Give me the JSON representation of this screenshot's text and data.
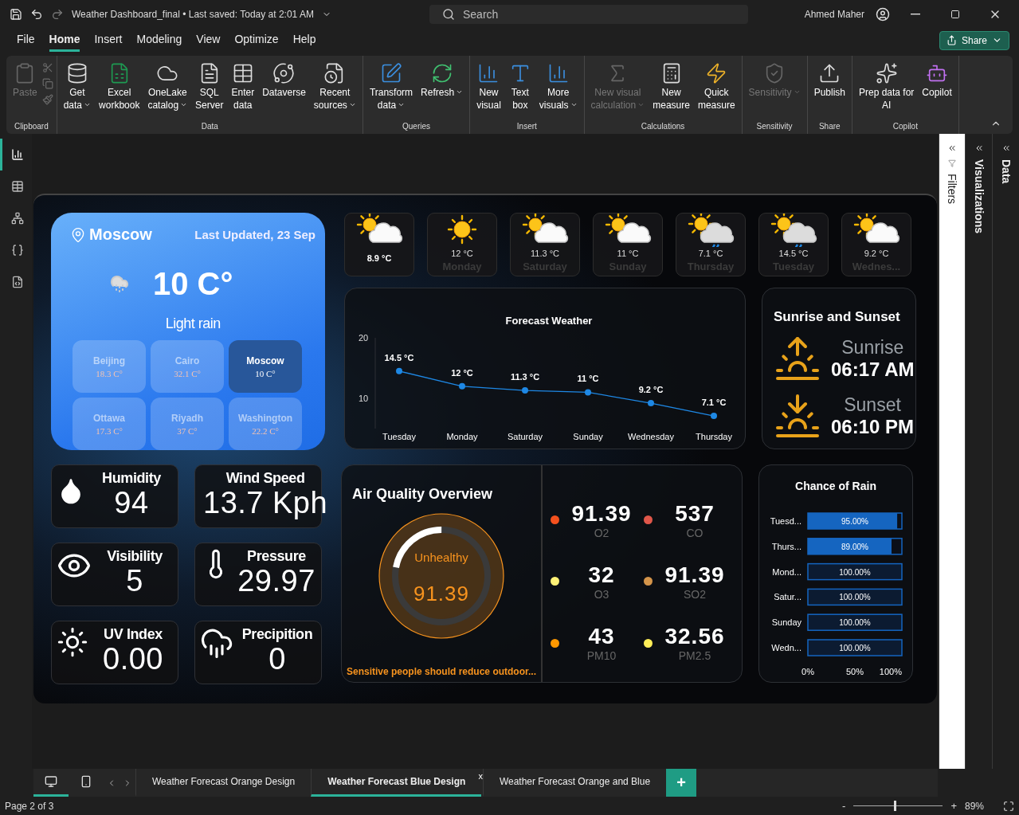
{
  "title_bar": {
    "title": "Weather Dashboard_final • Last saved: Today at 2:01 AM",
    "search": {
      "placeholder": "Search"
    },
    "user": "Ahmed Maher"
  },
  "menu": [
    {
      "label": "File",
      "selected": false
    },
    {
      "label": "Home",
      "selected": true
    },
    {
      "label": "Insert",
      "selected": false
    },
    {
      "label": "Modeling",
      "selected": false
    },
    {
      "label": "View",
      "selected": false
    },
    {
      "label": "Optimize",
      "selected": false
    },
    {
      "label": "Help",
      "selected": false
    }
  ],
  "share_button": "Share",
  "ribbon": [
    {
      "name": "Clipboard",
      "items": [
        {
          "kind": "large",
          "label": "Paste",
          "menu": false,
          "disabled": true
        },
        {
          "kind": "tools",
          "disabled": true
        }
      ]
    },
    {
      "name": "Data",
      "items": [
        {
          "kind": "large",
          "label": "Get\ndata",
          "menu": true,
          "disabled": false
        },
        {
          "kind": "large",
          "label": "Excel\nworkbook",
          "menu": false,
          "disabled": false
        },
        {
          "kind": "large",
          "label": "OneLake\ncatalog",
          "menu": true,
          "disabled": false
        },
        {
          "kind": "large",
          "label": "SQL\nServer",
          "menu": false,
          "disabled": false
        },
        {
          "kind": "large",
          "label": "Enter\ndata",
          "menu": false,
          "disabled": false
        },
        {
          "kind": "large",
          "label": "Dataverse",
          "menu": false,
          "disabled": false
        },
        {
          "kind": "large",
          "label": "Recent\nsources",
          "menu": true,
          "disabled": false
        }
      ]
    },
    {
      "name": "Queries",
      "items": [
        {
          "kind": "large",
          "label": "Transform\ndata",
          "menu": true,
          "disabled": false
        },
        {
          "kind": "large",
          "label": "Refresh",
          "menu": true,
          "disabled": false
        }
      ]
    },
    {
      "name": "Insert",
      "items": [
        {
          "kind": "large",
          "label": "New\nvisual",
          "menu": false,
          "disabled": false
        },
        {
          "kind": "large",
          "label": "Text\nbox",
          "menu": false,
          "disabled": false
        },
        {
          "kind": "large",
          "label": "More\nvisuals",
          "menu": true,
          "disabled": false
        }
      ]
    },
    {
      "name": "Calculations",
      "items": [
        {
          "kind": "large",
          "label": "New visual\ncalculation",
          "menu": true,
          "disabled": true
        },
        {
          "kind": "large",
          "label": "New\nmeasure",
          "menu": false,
          "disabled": false
        },
        {
          "kind": "large",
          "label": "Quick\nmeasure",
          "menu": false,
          "disabled": false
        }
      ]
    },
    {
      "name": "Sensitivity",
      "items": [
        {
          "kind": "large",
          "label": "Sensitivity",
          "menu": true,
          "disabled": true
        }
      ]
    },
    {
      "name": "Share",
      "items": [
        {
          "kind": "large",
          "label": "Publish",
          "menu": false,
          "disabled": false
        }
      ]
    },
    {
      "name": "Copilot",
      "items": [
        {
          "kind": "large",
          "label": "Prep data for\nAI",
          "menu": false,
          "disabled": false
        },
        {
          "kind": "large",
          "label": "Copilot",
          "menu": false,
          "disabled": false
        }
      ]
    }
  ],
  "left_nav": [
    {
      "selected": true
    },
    {
      "selected": false
    },
    {
      "selected": false
    },
    {
      "selected": false
    },
    {
      "selected": false
    }
  ],
  "city_card": {
    "location": "Moscow",
    "updated": "Last Updated, 23 Sep",
    "temperature": "10 C°",
    "condition": "Light rain",
    "cities": [
      {
        "name": "Beijing",
        "temp": "18.3 C°",
        "selected": false
      },
      {
        "name": "Cairo",
        "temp": "32.1 C°",
        "selected": false
      },
      {
        "name": "Moscow",
        "temp": "10 C°",
        "selected": true
      },
      {
        "name": "Ottawa",
        "temp": "17.3 C°",
        "selected": false
      },
      {
        "name": "Riyadh",
        "temp": "37 C°",
        "selected": false
      },
      {
        "name": "Washington",
        "temp": "22.2 C°",
        "selected": false
      }
    ]
  },
  "forecast_strip": [
    {
      "kind": "partly_cloudy",
      "temp": "8.9 °C",
      "selected": true
    },
    {
      "kind": "sunny",
      "temp": "12 °C",
      "day": "Monday",
      "selected": false
    },
    {
      "kind": "partly_cloudy",
      "temp": "11.3 °C",
      "day": "Saturday",
      "selected": false
    },
    {
      "kind": "partly_cloudy",
      "temp": "11 °C",
      "day": "Sunday",
      "selected": false
    },
    {
      "kind": "rain",
      "temp": "7.1 °C",
      "day": "Thursday",
      "selected": false
    },
    {
      "kind": "rain",
      "temp": "14.5 °C",
      "day": "Tuesday",
      "selected": false
    },
    {
      "kind": "partly_cloudy",
      "temp": "9.2 °C",
      "day": "Wednes...",
      "selected": false
    }
  ],
  "forecast_chart": {
    "chart_data": {
      "type": "line",
      "title": "Forecast Weather",
      "categories": [
        "Tuesday",
        "Monday",
        "Saturday",
        "Sunday",
        "Wednesday",
        "Thursday"
      ],
      "series": [
        {
          "color": "#1e88e5",
          "marker": true,
          "values": [
            14.5,
            12,
            11.3,
            11,
            9.2,
            7.1
          ]
        }
      ],
      "ylim": [
        5,
        20
      ],
      "yticks": [
        10,
        20
      ],
      "value_labels": [
        "14.5 °C",
        "12 °C",
        "11.3 °C",
        "11 °C",
        "9.2 °C",
        "7.1 °C"
      ]
    }
  },
  "sun": {
    "title": "Sunrise and Sunset",
    "events": [
      {
        "kind": "sunrise",
        "label": "Sunrise",
        "time": "06:17 AM"
      },
      {
        "kind": "sunset",
        "label": "Sunset",
        "time": "06:10 PM"
      }
    ]
  },
  "metrics": [
    {
      "kind": "humidity",
      "label": "Humidity",
      "value": "94"
    },
    {
      "kind": "wind",
      "label": "Wind Speed",
      "value": "13.7 Kph"
    },
    {
      "kind": "visibility",
      "label": "Visibility",
      "value": "5"
    },
    {
      "kind": "pressure",
      "label": "Pressure",
      "value": "29.97"
    },
    {
      "kind": "uv",
      "label": "UV Index",
      "value": "0.00"
    },
    {
      "kind": "precipitation",
      "label": "Precipition",
      "value": "0"
    }
  ],
  "air_quality": {
    "title": "Air Quality Overview",
    "status": "Unhealthy",
    "index": "91.39",
    "level": 0.22,
    "advice": "Sensitive people should reduce outdoor...",
    "pollutants": [
      {
        "value": "91.39",
        "label": "O2",
        "color": "#f4511e"
      },
      {
        "value": "537",
        "label": "CO",
        "color": "#e0574a"
      },
      {
        "value": "32",
        "label": "O3",
        "color": "#fff176"
      },
      {
        "value": "91.39",
        "label": "SO2",
        "color": "#d4944a"
      },
      {
        "value": "43",
        "label": "PM10",
        "color": "#ff9800"
      },
      {
        "value": "32.56",
        "label": "PM2.5",
        "color": "#ffee58"
      }
    ]
  },
  "rain_chart": {
    "chart_data": {
      "type": "bar",
      "orientation": "horizontal",
      "title": "Chance of Rain",
      "categories": [
        "Tuesd...",
        "Thurs...",
        "Mond...",
        "Satur...",
        "Sunday",
        "Wedn..."
      ],
      "series": [
        {
          "color": "#1565c0",
          "values": [
            95,
            89,
            100,
            100,
            100,
            100
          ]
        }
      ],
      "xlim": [
        0,
        100
      ],
      "xticks": [
        {
          "value": 0,
          "label": "0%"
        },
        {
          "value": 50,
          "label": "50%"
        },
        {
          "value": 100,
          "label": "100%"
        }
      ],
      "value_labels": [
        "95.00%",
        "89.00%",
        "100.00%",
        "100.00%",
        "100.00%",
        "100.00%"
      ]
    }
  },
  "panes": [
    {
      "label": "Filters",
      "kind": "light"
    },
    {
      "label": "Visualizations",
      "kind": "dark"
    },
    {
      "label": "Data",
      "kind": "dark"
    }
  ],
  "view_buttons": [
    {
      "kind": "desktop",
      "selected": true
    },
    {
      "kind": "mobile",
      "selected": false
    }
  ],
  "page_tabs": [
    {
      "label": "Weather Forecast Orange Design",
      "selected": false
    },
    {
      "label": "Weather Forecast Blue Design",
      "selected": true,
      "close": "x"
    },
    {
      "label": "Weather Forecast Orange and Blue",
      "selected": false
    }
  ],
  "add_page": "+",
  "status": {
    "page": "Page 2 of 3",
    "zoom_out": "-",
    "zoom_in": "+",
    "zoom": {
      "level": 0.45
    },
    "zoom_reading": "89%"
  }
}
